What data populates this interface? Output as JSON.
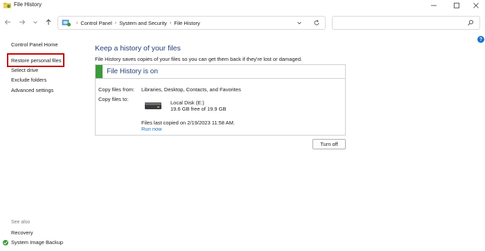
{
  "window": {
    "title": "File History",
    "icon": "file-history-folder-icon"
  },
  "address_bar": {
    "breadcrumbs": [
      "Control Panel",
      "System and Security",
      "File History"
    ],
    "search_placeholder": ""
  },
  "sidebar": {
    "home_label": "Control Panel Home",
    "links": [
      {
        "label": "Restore personal files",
        "highlighted": true
      },
      {
        "label": "Select drive"
      },
      {
        "label": "Exclude folders"
      },
      {
        "label": "Advanced settings"
      }
    ],
    "see_also": {
      "heading": "See also",
      "links": [
        {
          "label": "Recovery"
        },
        {
          "label": "System Image Backup"
        }
      ]
    }
  },
  "main": {
    "heading": "Keep a history of your files",
    "description": "File History saves copies of your files so you can get them back if they're lost or damaged.",
    "status": {
      "title": "File History is on",
      "color": "#3c9a3c"
    },
    "copy_from_label": "Copy files from:",
    "copy_from_value": "Libraries, Desktop, Contacts, and Favorites",
    "copy_to_label": "Copy files to:",
    "drive": {
      "name": "Local Disk (E:)",
      "free": "19.6 GB free of 19.9 GB"
    },
    "last_copied": "Files last copied on 2/19/2023 11:58 AM.",
    "run_now": "Run now",
    "turn_off": "Turn off"
  },
  "colors": {
    "heading": "#1e3d73",
    "link": "#1f6fb5",
    "highlight_box": "#c00000"
  }
}
